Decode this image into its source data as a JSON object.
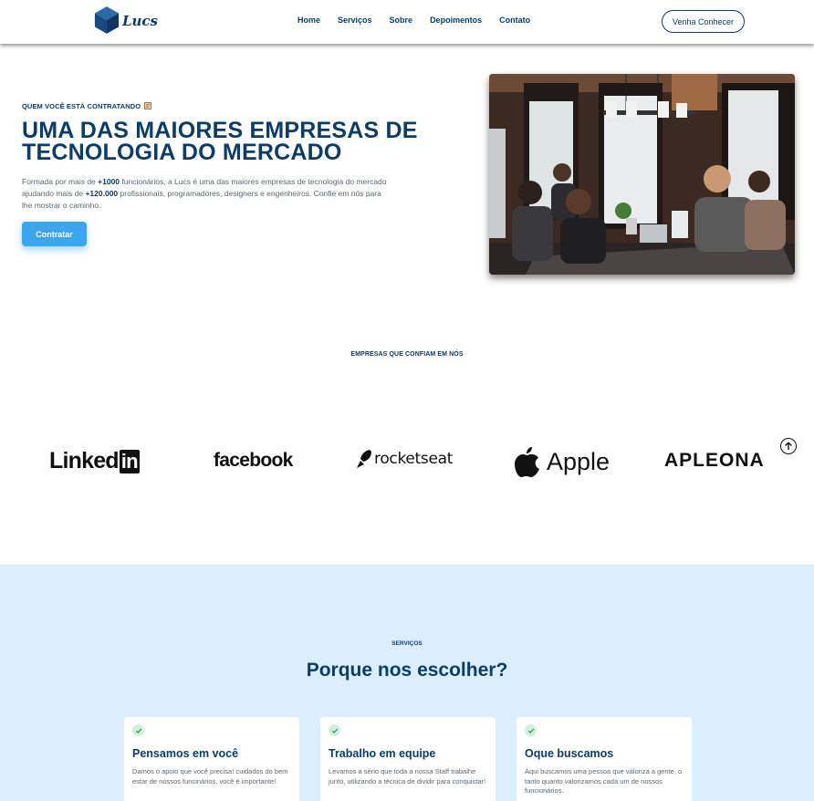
{
  "nav": {
    "logo_text": "Lucs",
    "links": [
      "Home",
      "Serviços",
      "Sobre",
      "Depoimentos",
      "Contato"
    ],
    "cta_label": "Venha Conhecer"
  },
  "hero": {
    "eyebrow": "QUEM VOCÊ ESTÁ CONTRATANDO",
    "title": "UMA DAS MAIORES EMPRESAS DE TECNOLOGIA DO MERCADO",
    "desc_part1": "Formada por mais de ",
    "desc_highlight1": "+1000",
    "desc_part2": " funcionários, a Lucs é uma das maiores empresas de tecnologia do mercado ajudando mais de ",
    "desc_highlight2": "+120.000",
    "desc_part3": " profissionais, programadores, designers e engenheiros. Confie em nós para lhe mostrar o caminho.",
    "button_label": "Contratar"
  },
  "companies": {
    "title": "EMPRESAS QUE CONFIAM EM NÓS",
    "logos": {
      "linkedin_a": "Linked",
      "linkedin_b": "in",
      "facebook": "facebook",
      "rocketseat": "rocketseat",
      "apple": "Apple",
      "apleona": "APLEONA"
    }
  },
  "services": {
    "eyebrow": "SERVIÇOS",
    "title": "Porque nos escolher?",
    "cards": [
      {
        "title": "Pensamos em você",
        "text": "Damos o apoio que você precisa! cuidados do bem estar de nossos funcinários, você é importante!"
      },
      {
        "title": "Trabalho em equipe",
        "text": "Levamos a sério que toda a nossa Staff trabalhe junto, utilizando a técnica de dividir para conquistar!"
      },
      {
        "title": "Oque buscamos",
        "text": "Aqui buscamos uma pessoa que valoriza a gente, o tanto quanto valorizamos cada um de nossos funcionários."
      }
    ]
  },
  "colors": {
    "brand": "#0b3c6b",
    "accent": "#3aa6f0",
    "services_bg": "#dbeefe",
    "check_bg": "#d3eedc"
  }
}
